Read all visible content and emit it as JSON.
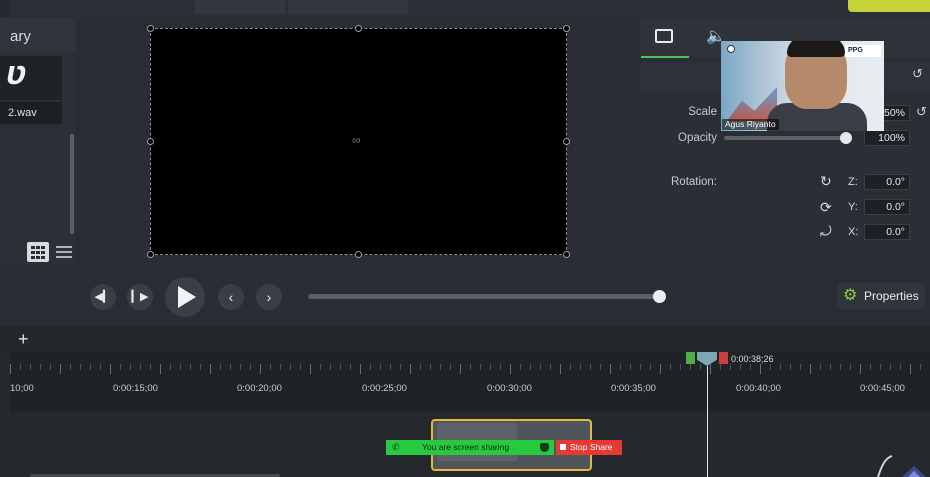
{
  "library": {
    "title": "ary",
    "file_name": "2.wav",
    "thumb_glyph": "ʋ"
  },
  "canvas": {
    "center_glyph": "∞"
  },
  "properties": {
    "scale_label": "Scale",
    "scale_value": "50%",
    "opacity_label": "Opacity",
    "opacity_value": "100%",
    "opacity_level": 1.0,
    "rotation_label": "Rotation:",
    "rot_z_label": "Z:",
    "rot_z_value": "0.0°",
    "rot_y_label": "Y:",
    "rot_y_value": "0.0°",
    "rot_x_label": "X:",
    "rot_x_value": "0.0°",
    "button_label": "Properties"
  },
  "video_overlay": {
    "participant_name": "Agus Riyanto",
    "logo_text": "PPG"
  },
  "playback": {
    "scrub_level": 0.99
  },
  "timeline": {
    "add_track": "+",
    "playhead_time": "0:00:38;26",
    "ruler_labels": [
      "10;00",
      "0:00:15;00",
      "0:00:20;00",
      "0:00:25;00",
      "0:00:30;00",
      "0:00:35;00",
      "0:00:40;00",
      "0:00:45;00"
    ]
  },
  "screen_share": {
    "status_text": "You are screen sharing",
    "stop_label": "Stop Share"
  },
  "colors": {
    "accent_green": "#4fc15a",
    "clip_border": "#e2b93a",
    "share_green": "#27c93f",
    "stop_red": "#e53935"
  }
}
